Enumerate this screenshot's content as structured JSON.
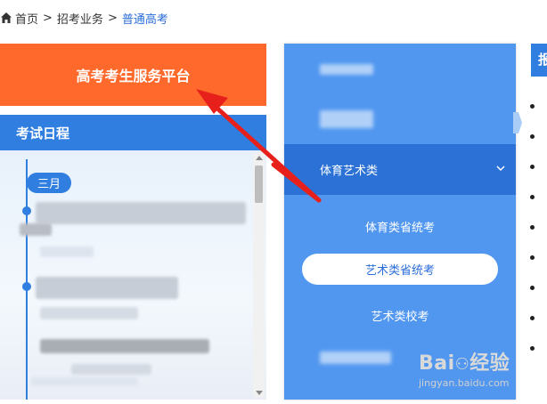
{
  "breadcrumb": {
    "items": [
      "首页",
      "招考业务",
      "普通高考"
    ],
    "separator": ">"
  },
  "banner": {
    "title": "高考考生服务平台"
  },
  "schedule": {
    "header": "考试日程",
    "month": "三月"
  },
  "menu": {
    "active_category": "体育艺术类",
    "sub_items": [
      "体育类省统考",
      "艺术类省统考",
      "艺术类校考"
    ],
    "selected_sub_item": "艺术类省统考"
  },
  "right_panel": {
    "header_char": "报"
  },
  "colors": {
    "orange": "#ff6a2c",
    "blue_header": "#2f7ee0",
    "menu_blue": "#5197f0",
    "menu_active": "#2c72d6",
    "arrow_red": "#e8201c"
  },
  "watermark": {
    "logo": "Bai经验",
    "url": "jingyan.baidu.com"
  }
}
